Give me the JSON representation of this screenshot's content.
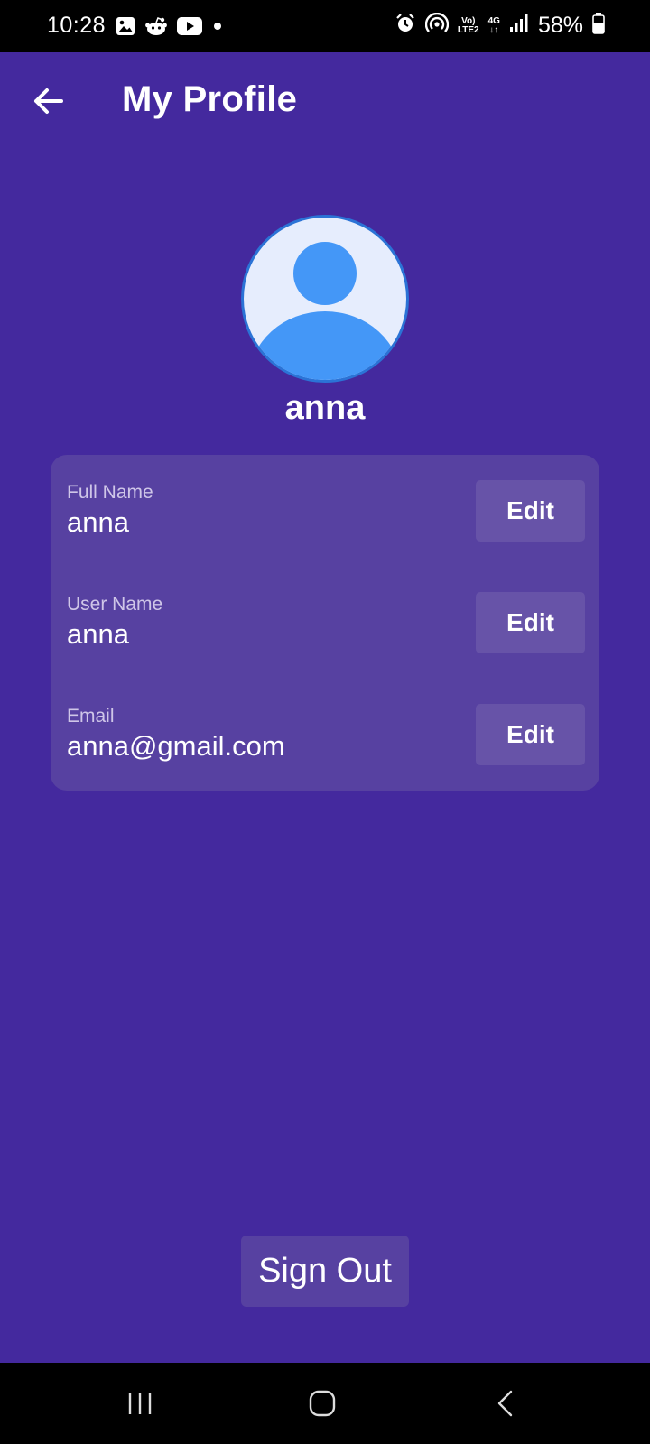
{
  "status_bar": {
    "time": "10:28",
    "network_top": "Vo)",
    "network_bottom": "LTE2",
    "mobile_data": "4G",
    "battery": "58%",
    "left_icons": [
      "image-icon",
      "reddit-icon",
      "youtube-icon",
      "dot-icon"
    ],
    "right_icons": [
      "alarm-icon",
      "hotspot-icon",
      "signal-icon",
      "battery-icon"
    ]
  },
  "header": {
    "title": "My Profile",
    "back_icon": "arrow-left-icon"
  },
  "profile": {
    "display_name": "anna",
    "avatar_icon": "user-avatar-icon"
  },
  "fields": [
    {
      "label": "Full Name",
      "value": "anna",
      "button": "Edit"
    },
    {
      "label": "User Name",
      "value": "anna",
      "button": "Edit"
    },
    {
      "label": "Email",
      "value": "anna@gmail.com",
      "button": "Edit"
    }
  ],
  "sign_out_label": "Sign Out",
  "nav_bar": {
    "icons": [
      "recent-apps-icon",
      "home-icon",
      "back-nav-icon"
    ]
  },
  "colors": {
    "background": "#44299e",
    "card": "#5741a1",
    "edit_button": "#6753a8",
    "avatar_fill": "#e6edfd",
    "avatar_figure": "#4497f7",
    "avatar_border": "#2b73d6"
  }
}
